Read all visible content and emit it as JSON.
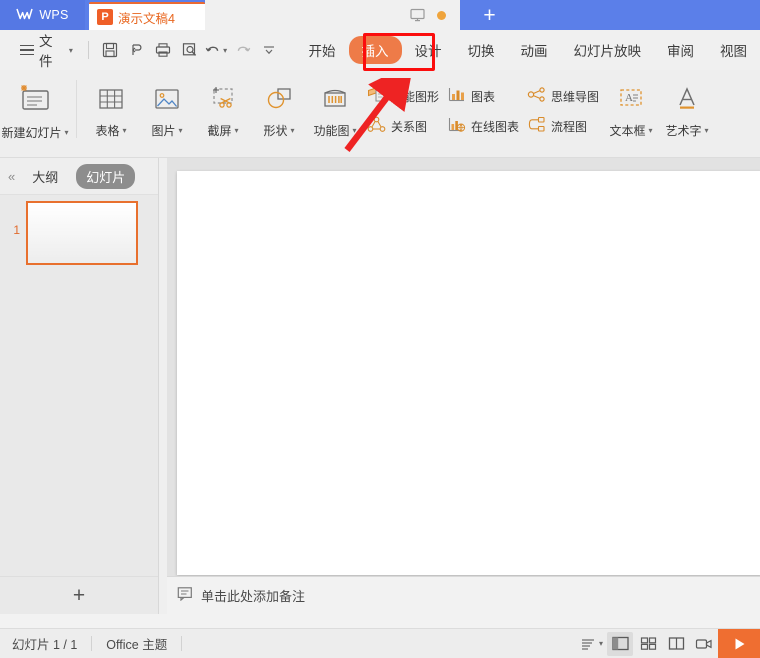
{
  "app": {
    "home_label": "WPS",
    "logo_icon": "wps-logo-icon"
  },
  "titlebar": {
    "doc_tab": {
      "label": "演示文稿4",
      "icon": "presentation-file-icon",
      "badge": "P"
    },
    "monitor_icon": "monitor-icon",
    "status_dot": "orange-status-dot",
    "new_tab_label": "+"
  },
  "quick_access": {
    "file_label": "文件",
    "menu_icon": "hamburger-menu-icon",
    "dropdown_icon": "chevron-down-icon",
    "buttons": [
      {
        "name": "save-button",
        "icon": "save-icon"
      },
      {
        "name": "cloud-sync-button",
        "icon": "cloud-sync-icon"
      },
      {
        "name": "print-button",
        "icon": "print-icon"
      },
      {
        "name": "print-preview-button",
        "icon": "print-preview-icon"
      },
      {
        "name": "undo-button",
        "icon": "undo-icon"
      },
      {
        "name": "redo-button",
        "icon": "redo-icon"
      },
      {
        "name": "customize-qat-button",
        "icon": "chevron-double-down-icon"
      }
    ]
  },
  "ribbon_tabs": {
    "items": [
      {
        "label": "开始",
        "active": false
      },
      {
        "label": "插入",
        "active": true
      },
      {
        "label": "设计",
        "active": false
      },
      {
        "label": "切换",
        "active": false
      },
      {
        "label": "动画",
        "active": false
      },
      {
        "label": "幻灯片放映",
        "active": false
      },
      {
        "label": "审阅",
        "active": false
      },
      {
        "label": "视图",
        "active": false
      }
    ],
    "active_index": 1
  },
  "ribbon": {
    "new_slide": {
      "label": "新建幻灯片",
      "icon": "new-slide-icon",
      "has_dropdown": true
    },
    "group_media": [
      {
        "label": "表格",
        "icon": "table-icon",
        "has_dropdown": true
      },
      {
        "label": "图片",
        "icon": "picture-icon",
        "has_dropdown": true
      },
      {
        "label": "截屏",
        "icon": "screenshot-scissors-icon",
        "has_dropdown": true
      },
      {
        "label": "形状",
        "icon": "shapes-icon",
        "has_dropdown": true
      },
      {
        "label": "功能图",
        "icon": "function-chart-icon",
        "has_dropdown": true
      }
    ],
    "group_graphics": [
      {
        "label": "智能图形",
        "icon": "smartart-icon"
      },
      {
        "label": "关系图",
        "icon": "relationship-diagram-icon"
      },
      {
        "label": "图表",
        "icon": "chart-icon"
      },
      {
        "label": "在线图表",
        "icon": "online-chart-icon"
      },
      {
        "label": "思维导图",
        "icon": "mindmap-icon"
      },
      {
        "label": "流程图",
        "icon": "flowchart-icon"
      }
    ],
    "group_text": [
      {
        "label": "文本框",
        "icon": "textbox-icon",
        "has_dropdown": true
      },
      {
        "label": "艺术字",
        "icon": "wordart-icon",
        "has_dropdown": true
      }
    ]
  },
  "left_panel": {
    "collapse_icon": "collapse-left-icon",
    "tabs": [
      {
        "label": "大纲",
        "active": false
      },
      {
        "label": "幻灯片",
        "active": true
      }
    ],
    "slides": [
      {
        "number": "1",
        "selected": true
      }
    ],
    "add_slide_label": "+"
  },
  "notes": {
    "icon": "notes-comment-icon",
    "placeholder": "单击此处添加备注"
  },
  "statusbar": {
    "slide_count": "幻灯片 1 / 1",
    "theme": "Office 主题",
    "view_buttons": [
      {
        "name": "outline-sort-button",
        "icon": "text-lines-icon",
        "active": false,
        "has_dropdown": true
      },
      {
        "name": "normal-view-button",
        "icon": "normal-view-icon",
        "active": true
      },
      {
        "name": "slide-sorter-button",
        "icon": "slide-sorter-icon",
        "active": false
      },
      {
        "name": "reading-view-button",
        "icon": "reading-view-icon",
        "active": false
      },
      {
        "name": "record-view-button",
        "icon": "record-camera-icon",
        "active": false
      }
    ],
    "play_button": {
      "name": "start-slideshow-button",
      "icon": "play-triangle-icon"
    }
  },
  "annotations": {
    "highlight_target": "插入",
    "highlight_color": "#fb0d0d",
    "arrow_target": "智能图形",
    "arrow_color": "#ee2323"
  },
  "colors": {
    "brand_blue": "#5b7fe9",
    "accent_orange": "#ee7b48",
    "selection_orange": "#e8702e",
    "annotation_red": "#fb0d0d"
  }
}
